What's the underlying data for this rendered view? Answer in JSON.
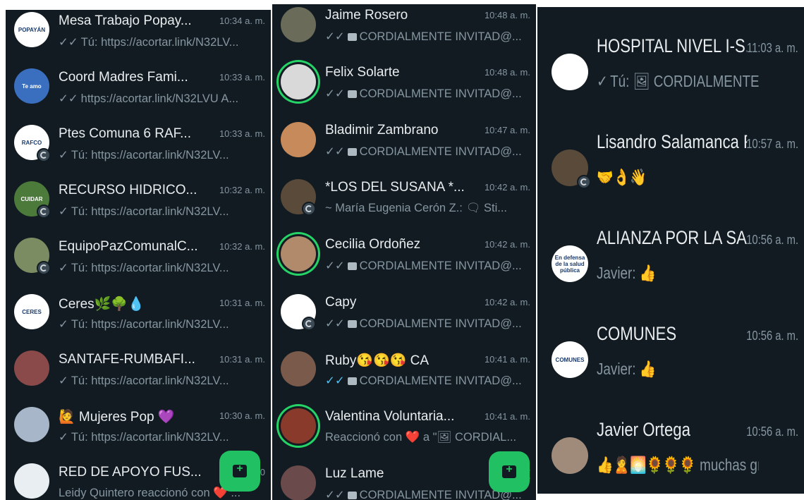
{
  "panel1": {
    "chats": [
      {
        "name": "Mesa Trabajo Popay...",
        "time": "10:34 a. m.",
        "tick": "✓✓",
        "preview": "Tú: https://acortar.link/N32LV...",
        "avatar_text": "POPAYÁN",
        "avatar_color": "#ffffff"
      },
      {
        "name": "Coord Madres Fami...",
        "time": "10:33 a. m.",
        "tick": "✓✓",
        "preview": "https://acortar.link/N32LVU  A...",
        "avatar_text": "Te amo",
        "avatar_color": "#3a6fbf"
      },
      {
        "name": "Ptes Comuna 6 RAF...",
        "time": "10:33 a. m.",
        "tick": "✓",
        "preview": "Tú: https://acortar.link/N32LV...",
        "avatar_text": "RAFCO",
        "avatar_color": "#ffffff"
      },
      {
        "name": "RECURSO HIDRICO...",
        "time": "10:32 a. m.",
        "tick": "✓",
        "preview": "Tú: https://acortar.link/N32LV...",
        "avatar_text": "CUIDAR",
        "avatar_color": "#4c7a3a"
      },
      {
        "name": "EquipoPazComunalC...",
        "time": "10:32 a. m.",
        "tick": "✓",
        "preview": "Tú: https://acortar.link/N32LV...",
        "avatar_text": "",
        "avatar_color": "#7b8b62"
      },
      {
        "name": "Ceres🌿🌳💧",
        "time": "10:31 a. m.",
        "tick": "✓",
        "preview": "Tú: https://acortar.link/N32LV...",
        "avatar_text": "CERES",
        "avatar_color": "#ffffff"
      },
      {
        "name": "SANTAFE-RUMBAFI...",
        "time": "10:31 a. m.",
        "tick": "✓",
        "preview": "Tú: https://acortar.link/N32LV...",
        "avatar_text": "",
        "avatar_color": "#8a4a4a"
      },
      {
        "name": "🙋 Mujeres Pop 💜",
        "time": "10:30 a. m.",
        "tick": "✓",
        "preview": "Tú: https://acortar.link/N32LV...",
        "avatar_text": "",
        "avatar_color": "#a7b6c9"
      },
      {
        "name": "RED DE APOYO FUS...",
        "time": "10",
        "tick": "",
        "preview": "Leidy Quintero reaccionó con ❤️ ...",
        "avatar_text": "",
        "avatar_color": "#e8eef2"
      }
    ]
  },
  "panel2": {
    "chats": [
      {
        "name": "Jaime Rosero",
        "time": "10:48 a. m.",
        "tick": "✓✓",
        "preview": "CORDIALMENTE INVITAD@...",
        "image": true,
        "avatar_color": "#6b6b5a",
        "ring": false
      },
      {
        "name": "Felix Solarte",
        "time": "10:48 a. m.",
        "tick": "✓✓",
        "preview": "CORDIALMENTE INVITAD@...",
        "image": true,
        "avatar_color": "#d9d9d9",
        "ring": true
      },
      {
        "name": "Bladimir Zambrano",
        "time": "10:47 a. m.",
        "tick": "✓✓",
        "preview": "CORDIALMENTE INVITAD@...",
        "image": true,
        "avatar_color": "#c78a5a",
        "ring": false
      },
      {
        "name": "*LOS DEL SUSANA *...",
        "time": "10:42 a. m.",
        "tick": "",
        "preview": "~ María Eugenia Cerón Z.: 🗨 Sti...",
        "image": false,
        "avatar_color": "#5a4a3a",
        "ring": false
      },
      {
        "name": "Cecilia Ordoñez",
        "time": "10:42 a. m.",
        "tick": "✓✓",
        "preview": "CORDIALMENTE INVITAD@...",
        "image": true,
        "avatar_color": "#b08a6a",
        "ring": true
      },
      {
        "name": "Capy",
        "time": "10:42 a. m.",
        "tick": "✓✓",
        "preview": "CORDIALMENTE INVITAD@...",
        "image": true,
        "avatar_color": "#ffffff",
        "ring": false
      },
      {
        "name": "Ruby😘😘😘 CA",
        "time": "10:41 a. m.",
        "tick": "✓✓",
        "tick_read": true,
        "preview": "CORDIALMENTE INVITAD@...",
        "image": true,
        "avatar_color": "#7a5a4a",
        "ring": false
      },
      {
        "name": "Valentina Voluntaria...",
        "time": "10:41 a. m.",
        "tick": "",
        "preview": "Reaccionó con ❤️ a \"🖼 CORDIAL...",
        "image": false,
        "avatar_color": "#8a3a2a",
        "ring": true
      },
      {
        "name": "Luz Lame",
        "time": "1(",
        "tick": "✓✓",
        "preview": "CORDIALMENTE INVITAD@...",
        "image": true,
        "avatar_color": "#6a4a4a",
        "ring": false
      }
    ]
  },
  "panel3": {
    "chats": [
      {
        "name": "HOSPITAL NIVEL I-S...",
        "time": "11:03 a. m.",
        "tick": "✓",
        "preview": "Tú: 🖼 CORDIALMENTE INVI...",
        "avatar_text": "",
        "avatar_color": "#ffffff"
      },
      {
        "name": "Lisandro Salamanca R",
        "time": "10:57 a. m.",
        "tick": "",
        "preview": "🤝👌👋",
        "avatar_text": "",
        "avatar_color": "#5a4a3a"
      },
      {
        "name": "ALIANZA POR LA SA...",
        "time": "10:56 a. m.",
        "tick": "",
        "preview": "Javier: 👍",
        "avatar_text": "En defensa de la salud pública",
        "avatar_color": "#ffffff"
      },
      {
        "name": "COMUNES",
        "time": "10:56 a. m.",
        "tick": "",
        "preview": "Javier: 👍",
        "avatar_text": "COMUNES",
        "avatar_color": "#ffffff"
      },
      {
        "name": "Javier Ortega",
        "time": "10:56 a. m.",
        "tick": "",
        "preview": "👍🙎🌅🌻🌻🌻 muchas gracias,...",
        "avatar_text": "",
        "avatar_color": "#a08a7a"
      }
    ]
  },
  "colors": {
    "background": "#111b21",
    "primary_text": "#e9edef",
    "secondary_text": "#8696a0",
    "fab": "#21c063",
    "status_ring": "#25d366",
    "read_tick": "#53bdeb"
  },
  "icons": {
    "fab": "new-chat-icon",
    "media": "image-icon",
    "status": "status-ring-icon"
  }
}
